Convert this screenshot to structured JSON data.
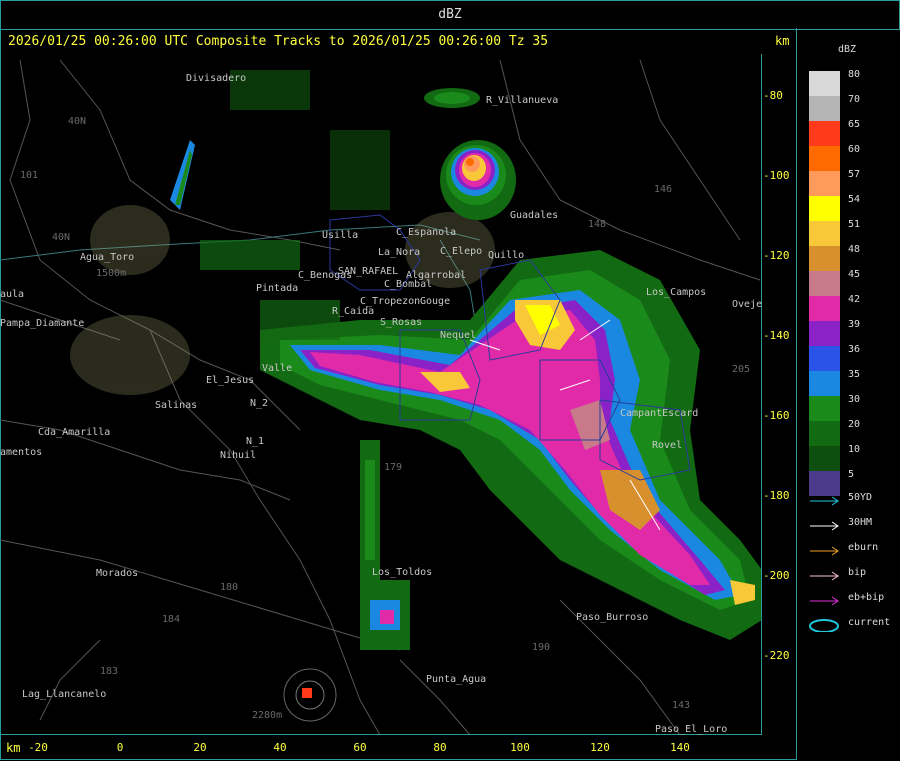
{
  "window": {
    "title": "dBZ"
  },
  "header": {
    "text": "2026/01/25 00:26:00 UTC Composite Tracks to 2026/01/25 00:26:00 Tz 35",
    "km_top": "km",
    "km_bottom": "km"
  },
  "axes": {
    "y_ticks": [
      "-80",
      "-100",
      "-120",
      "-140",
      "-160",
      "-180",
      "-200",
      "-220"
    ],
    "x_ticks": [
      "-20",
      "0",
      "20",
      "40",
      "60",
      "80",
      "100",
      "120",
      "140"
    ]
  },
  "legend": {
    "title": "dBZ",
    "scale": [
      {
        "value": "80",
        "color": "#d8d8d8"
      },
      {
        "value": "70",
        "color": "#b4b4b4"
      },
      {
        "value": "65",
        "color": "#ff3a1a"
      },
      {
        "value": "60",
        "color": "#ff6a00"
      },
      {
        "value": "57",
        "color": "#ff9a5a"
      },
      {
        "value": "54",
        "color": "#ffff00"
      },
      {
        "value": "51",
        "color": "#f8c838"
      },
      {
        "value": "48",
        "color": "#d8902e"
      },
      {
        "value": "45",
        "color": "#c87a8a"
      },
      {
        "value": "42",
        "color": "#e02aa8"
      },
      {
        "value": "39",
        "color": "#8a22c8"
      },
      {
        "value": "36",
        "color": "#2a54e8"
      },
      {
        "value": "35",
        "color": "#1a88e0"
      },
      {
        "value": "30",
        "color": "#1a8a1a"
      },
      {
        "value": "20",
        "color": "#126a12"
      },
      {
        "value": "10",
        "color": "#0e4e0e"
      },
      {
        "value": "5",
        "color": "#4a3a8a"
      }
    ],
    "tracks": [
      {
        "label": "50YD",
        "color": "#20c8e0"
      },
      {
        "label": "30HM",
        "color": "#ffffff"
      },
      {
        "label": "eburn",
        "color": "#f0a020"
      },
      {
        "label": "bip",
        "color": "#ffc0e0"
      },
      {
        "label": "eb+bip",
        "color": "#e030e0"
      },
      {
        "label": "current",
        "color": "#20c8e0"
      }
    ]
  },
  "places": {
    "divisadero": "Divisadero",
    "villanueva": "R_Villanueva",
    "guadales": "Guadales",
    "c_espanola": "C_Espanola",
    "c_elepo": "C_Elepo",
    "quillo": "Quillo",
    "los_campos": "Los_Campos",
    "uveje": "Oveje",
    "usilla": "Usilla",
    "la_nora": "La_Nora",
    "bombal": "C_Bombal",
    "benogas": "C_Benogas",
    "san_rafael": "SAN_RAFAEL",
    "algarrobal": "Algarrobal",
    "pintada": "Pintada",
    "tropezon": "C_Tropezon",
    "gouge": "Gouge",
    "caida": "R_Caida",
    "s_rosas": "S_Rosas",
    "nequel": "Nequel",
    "valle": "Valle",
    "el_jesus": "El_Jesus",
    "salinas": "Salinas",
    "n2": "N_2",
    "n1": "N_1",
    "nihuil": "Nihuil",
    "cda_amarilla": "Cda_Amarilla",
    "amentos": "amentos",
    "agua_toro": "Agua_Toro",
    "pampa_diamante": "Pampa_Diamante",
    "aula": "aula",
    "morados": "Morados",
    "los_toldos": "Los_Toldos",
    "punta_agua": "Punta_Agua",
    "paso_burroso": "Paso_Burroso",
    "lag_llancanelo": "Lag_Llancanelo",
    "paso_el_loro": "Paso_El_Loro",
    "escard": "CampantEscard",
    "rovel": "Rovel"
  },
  "numbers": {
    "n101": "101",
    "n40n": "40N",
    "n40n2": "40N",
    "n146": "146",
    "n148": "148",
    "n205": "205",
    "n180": "180",
    "n184": "184",
    "n183": "183",
    "n179": "179",
    "n190": "190",
    "n143": "143",
    "n2280": "2280m",
    "n1500": "1500m"
  }
}
